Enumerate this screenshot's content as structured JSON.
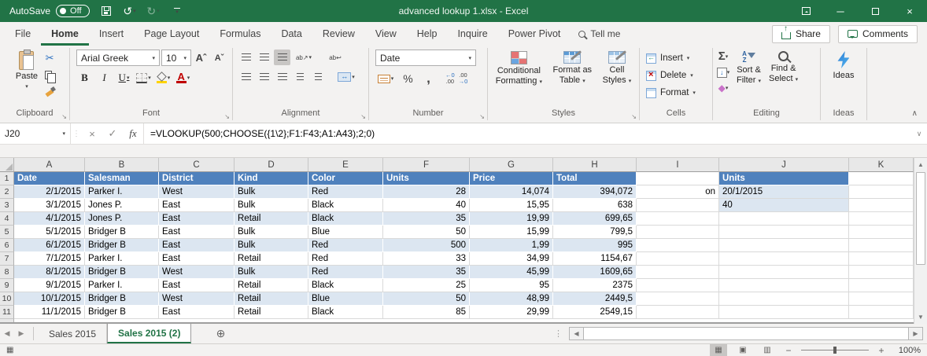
{
  "title_bar": {
    "autosave_label": "AutoSave",
    "autosave_state": "Off",
    "title": "advanced lookup 1.xlsx - Excel"
  },
  "ribbon_tabs": [
    {
      "label": "File"
    },
    {
      "label": "Home",
      "active": true
    },
    {
      "label": "Insert"
    },
    {
      "label": "Page Layout"
    },
    {
      "label": "Formulas"
    },
    {
      "label": "Data"
    },
    {
      "label": "Review"
    },
    {
      "label": "View"
    },
    {
      "label": "Help"
    },
    {
      "label": "Inquire"
    },
    {
      "label": "Power Pivot"
    }
  ],
  "tell_me_label": "Tell me",
  "share_label": "Share",
  "comments_label": "Comments",
  "ribbon": {
    "clipboard": {
      "group_label": "Clipboard",
      "paste_label": "Paste"
    },
    "font": {
      "group_label": "Font",
      "font_name": "Arial Greek",
      "font_size": "10"
    },
    "alignment": {
      "group_label": "Alignment"
    },
    "number": {
      "group_label": "Number",
      "format": "Date"
    },
    "styles": {
      "group_label": "Styles",
      "conditional_formatting_1": "Conditional",
      "conditional_formatting_2": "Formatting",
      "format_as_table_1": "Format as",
      "format_as_table_2": "Table",
      "cell_styles_1": "Cell",
      "cell_styles_2": "Styles"
    },
    "cells": {
      "group_label": "Cells",
      "insert": "Insert",
      "delete": "Delete",
      "format": "Format"
    },
    "editing": {
      "group_label": "Editing",
      "sort_filter_1": "Sort &",
      "sort_filter_2": "Filter",
      "find_select_1": "Find &",
      "find_select_2": "Select"
    },
    "ideas": {
      "group_label": "Ideas",
      "ideas_label": "Ideas"
    }
  },
  "formula_bar": {
    "name_box": "J20",
    "formula": "=VLOOKUP(500;CHOOSE({1\\2};F1:F43;A1:A43);2;0)"
  },
  "grid": {
    "columns": [
      "A",
      "B",
      "C",
      "D",
      "E",
      "F",
      "G",
      "H",
      "I",
      "J",
      "K"
    ],
    "rows": [
      {
        "num": "1",
        "cells": [
          {
            "t": "Date",
            "s": "hdr"
          },
          {
            "t": "Salesman",
            "s": "hdr"
          },
          {
            "t": "District",
            "s": "hdr"
          },
          {
            "t": "Kind",
            "s": "hdr"
          },
          {
            "t": "Color",
            "s": "hdr"
          },
          {
            "t": "Units",
            "s": "hdr"
          },
          {
            "t": "Price",
            "s": "hdr"
          },
          {
            "t": "Total",
            "s": "hdr"
          },
          {
            "t": "",
            "s": ""
          },
          {
            "t": "Units",
            "s": "hdr"
          },
          {
            "t": "",
            "s": ""
          }
        ]
      },
      {
        "num": "2",
        "cells": [
          {
            "t": "2/1/2015",
            "s": "band right"
          },
          {
            "t": "Parker I.",
            "s": "band"
          },
          {
            "t": "West",
            "s": "band"
          },
          {
            "t": "Bulk",
            "s": "band"
          },
          {
            "t": "Red",
            "s": "band"
          },
          {
            "t": "28",
            "s": "band right"
          },
          {
            "t": "14,074",
            "s": "band right"
          },
          {
            "t": "394,072",
            "s": "band right"
          },
          {
            "t": "on",
            "s": "right"
          },
          {
            "t": "20/1/2015",
            "s": "jfill"
          },
          {
            "t": "",
            "s": ""
          }
        ]
      },
      {
        "num": "3",
        "cells": [
          {
            "t": "3/1/2015",
            "s": "right"
          },
          {
            "t": "Jones P.",
            "s": ""
          },
          {
            "t": "East",
            "s": ""
          },
          {
            "t": "Bulk",
            "s": ""
          },
          {
            "t": "Black",
            "s": ""
          },
          {
            "t": "40",
            "s": "right"
          },
          {
            "t": "15,95",
            "s": "right"
          },
          {
            "t": "638",
            "s": "right"
          },
          {
            "t": "",
            "s": ""
          },
          {
            "t": "40",
            "s": "jfill"
          },
          {
            "t": "",
            "s": ""
          }
        ]
      },
      {
        "num": "4",
        "cells": [
          {
            "t": "4/1/2015",
            "s": "band right"
          },
          {
            "t": "Jones P.",
            "s": "band"
          },
          {
            "t": "East",
            "s": "band"
          },
          {
            "t": "Retail",
            "s": "band"
          },
          {
            "t": "Black",
            "s": "band"
          },
          {
            "t": "35",
            "s": "band right"
          },
          {
            "t": "19,99",
            "s": "band right"
          },
          {
            "t": "699,65",
            "s": "band right"
          },
          {
            "t": "",
            "s": ""
          },
          {
            "t": "",
            "s": ""
          },
          {
            "t": "",
            "s": ""
          }
        ]
      },
      {
        "num": "5",
        "cells": [
          {
            "t": "5/1/2015",
            "s": "right"
          },
          {
            "t": "Bridger B",
            "s": ""
          },
          {
            "t": "East",
            "s": ""
          },
          {
            "t": "Bulk",
            "s": ""
          },
          {
            "t": "Blue",
            "s": ""
          },
          {
            "t": "50",
            "s": "right"
          },
          {
            "t": "15,99",
            "s": "right"
          },
          {
            "t": "799,5",
            "s": "right"
          },
          {
            "t": "",
            "s": ""
          },
          {
            "t": "",
            "s": ""
          },
          {
            "t": "",
            "s": ""
          }
        ]
      },
      {
        "num": "6",
        "cells": [
          {
            "t": "6/1/2015",
            "s": "band right"
          },
          {
            "t": "Bridger B",
            "s": "band"
          },
          {
            "t": "East",
            "s": "band"
          },
          {
            "t": "Bulk",
            "s": "band"
          },
          {
            "t": "Red",
            "s": "band"
          },
          {
            "t": "500",
            "s": "band right"
          },
          {
            "t": "1,99",
            "s": "band right"
          },
          {
            "t": "995",
            "s": "band right"
          },
          {
            "t": "",
            "s": ""
          },
          {
            "t": "",
            "s": ""
          },
          {
            "t": "",
            "s": ""
          }
        ]
      },
      {
        "num": "7",
        "cells": [
          {
            "t": "7/1/2015",
            "s": "right"
          },
          {
            "t": "Parker I.",
            "s": ""
          },
          {
            "t": "East",
            "s": ""
          },
          {
            "t": "Retail",
            "s": ""
          },
          {
            "t": "Red",
            "s": ""
          },
          {
            "t": "33",
            "s": "right"
          },
          {
            "t": "34,99",
            "s": "right"
          },
          {
            "t": "1154,67",
            "s": "right"
          },
          {
            "t": "",
            "s": ""
          },
          {
            "t": "",
            "s": ""
          },
          {
            "t": "",
            "s": ""
          }
        ]
      },
      {
        "num": "8",
        "cells": [
          {
            "t": "8/1/2015",
            "s": "band right"
          },
          {
            "t": "Bridger B",
            "s": "band"
          },
          {
            "t": "West",
            "s": "band"
          },
          {
            "t": "Bulk",
            "s": "band"
          },
          {
            "t": "Red",
            "s": "band"
          },
          {
            "t": "35",
            "s": "band right"
          },
          {
            "t": "45,99",
            "s": "band right"
          },
          {
            "t": "1609,65",
            "s": "band right"
          },
          {
            "t": "",
            "s": ""
          },
          {
            "t": "",
            "s": ""
          },
          {
            "t": "",
            "s": ""
          }
        ]
      },
      {
        "num": "9",
        "cells": [
          {
            "t": "9/1/2015",
            "s": "right"
          },
          {
            "t": "Parker I.",
            "s": ""
          },
          {
            "t": "East",
            "s": ""
          },
          {
            "t": "Retail",
            "s": ""
          },
          {
            "t": "Black",
            "s": ""
          },
          {
            "t": "25",
            "s": "right"
          },
          {
            "t": "95",
            "s": "right"
          },
          {
            "t": "2375",
            "s": "right"
          },
          {
            "t": "",
            "s": ""
          },
          {
            "t": "",
            "s": ""
          },
          {
            "t": "",
            "s": ""
          }
        ]
      },
      {
        "num": "10",
        "cells": [
          {
            "t": "10/1/2015",
            "s": "band right"
          },
          {
            "t": "Bridger B",
            "s": "band"
          },
          {
            "t": "West",
            "s": "band"
          },
          {
            "t": "Retail",
            "s": "band"
          },
          {
            "t": "Blue",
            "s": "band"
          },
          {
            "t": "50",
            "s": "band right"
          },
          {
            "t": "48,99",
            "s": "band right"
          },
          {
            "t": "2449,5",
            "s": "band right"
          },
          {
            "t": "",
            "s": ""
          },
          {
            "t": "",
            "s": ""
          },
          {
            "t": "",
            "s": ""
          }
        ]
      },
      {
        "num": "11",
        "cells": [
          {
            "t": "11/1/2015",
            "s": "right"
          },
          {
            "t": "Bridger B",
            "s": ""
          },
          {
            "t": "East",
            "s": ""
          },
          {
            "t": "Retail",
            "s": ""
          },
          {
            "t": "Black",
            "s": ""
          },
          {
            "t": "85",
            "s": "right"
          },
          {
            "t": "29,99",
            "s": "right"
          },
          {
            "t": "2549,15",
            "s": "right"
          },
          {
            "t": "",
            "s": ""
          },
          {
            "t": "",
            "s": ""
          },
          {
            "t": "",
            "s": ""
          }
        ]
      }
    ]
  },
  "sheet_tabs": {
    "tabs": [
      {
        "label": "Sales 2015"
      },
      {
        "label": "Sales 2015 (2)",
        "active": true
      }
    ]
  },
  "status_bar": {
    "zoom_level": "100%"
  },
  "icons": {
    "dropdown": "▾",
    "undo": "↺",
    "redo": "↻",
    "cut": "✂",
    "bold": "B",
    "italic": "I",
    "underline": "U",
    "grow_font": "Aˆ",
    "shrink_font": "Aˇ",
    "orientation": "ab↗",
    "wrap_text": "ab↩",
    "percent": "%",
    "comma": ",",
    "sum": "Σ",
    "fill_down": "↓",
    "eraser": "◆",
    "cancel": "×",
    "check": "✓",
    "fx": "fx",
    "expand": "∨",
    "handle_dots": "⋮",
    "launcher": "↘",
    "collapse_ribbon": "∧",
    "minimize": "─",
    "close": "×",
    "prev": "◀",
    "next": "▶",
    "up": "▲",
    "down": "▼",
    "add_sheet": "⊕",
    "view_normal": "▦",
    "view_page_layout": "▣",
    "view_page_break": "▥",
    "zoom_out": "−",
    "zoom_in": "+",
    "inc_dec_top": "←0",
    "inc_dec_bottom": ".00",
    "dec_dec_top": ".00",
    "dec_dec_bottom": "→0",
    "az_a": "A",
    "az_z": "Z"
  },
  "colors": {
    "excel_green": "#217346",
    "table_header_blue": "#4f81bd",
    "band_blue": "#dce6f1"
  }
}
